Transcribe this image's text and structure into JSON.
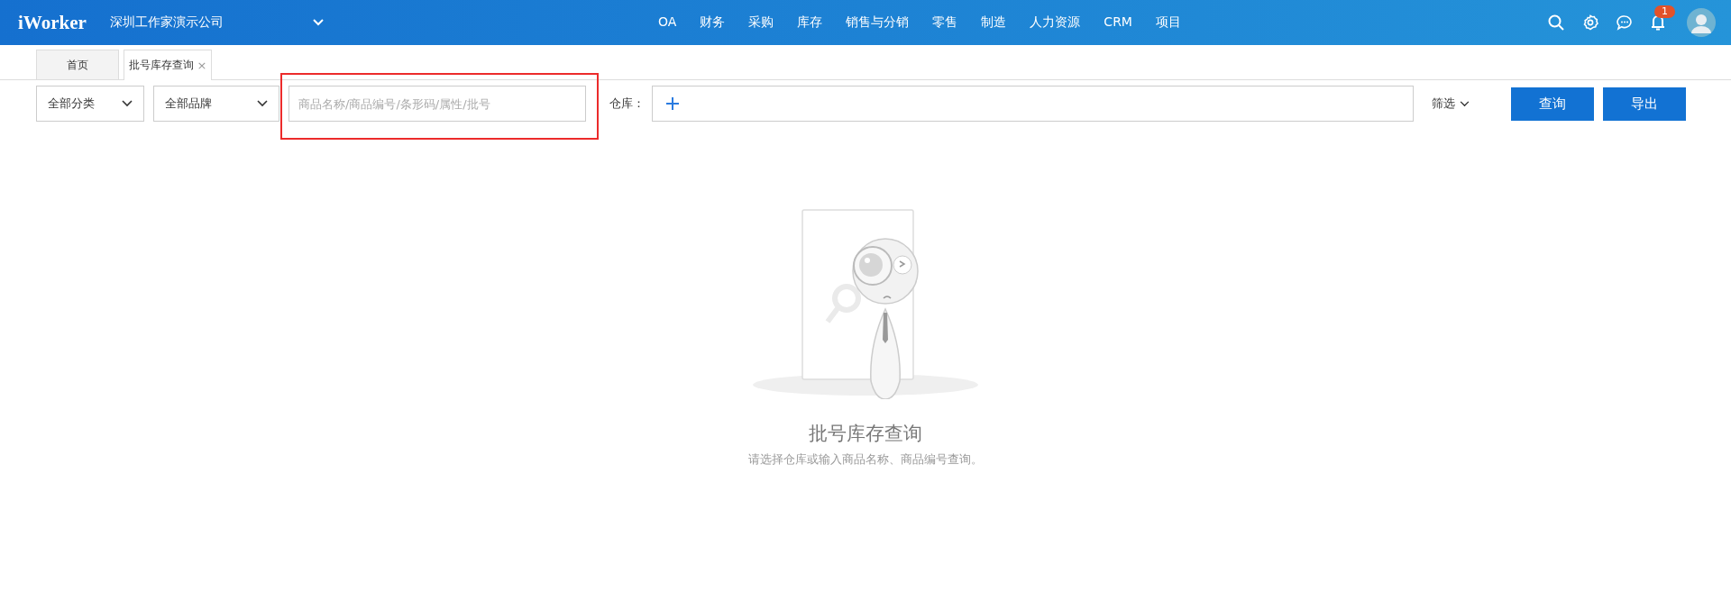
{
  "header": {
    "logo": "iWorker",
    "company": "深圳工作家演示公司",
    "nav": [
      "OA",
      "财务",
      "采购",
      "库存",
      "销售与分销",
      "零售",
      "制造",
      "人力资源",
      "CRM",
      "项目"
    ],
    "notification_count": "1"
  },
  "tabs": [
    {
      "label": "首页",
      "selected": false
    },
    {
      "label": "批号库存查询",
      "selected": true,
      "close": "×"
    }
  ],
  "toolbar": {
    "category": "全部分类",
    "brand": "全部品牌",
    "search": {
      "placeholder": "商品名称/商品编号/条形码/属性/批号",
      "highlighted": true
    },
    "warehouse_label": "仓库：",
    "filter": "筛选",
    "buttons": [
      "查询",
      "导出"
    ]
  },
  "empty_state": {
    "title": "批号库存查询",
    "message": "请选择仓库或输入商品名称、商品编号查询。"
  }
}
